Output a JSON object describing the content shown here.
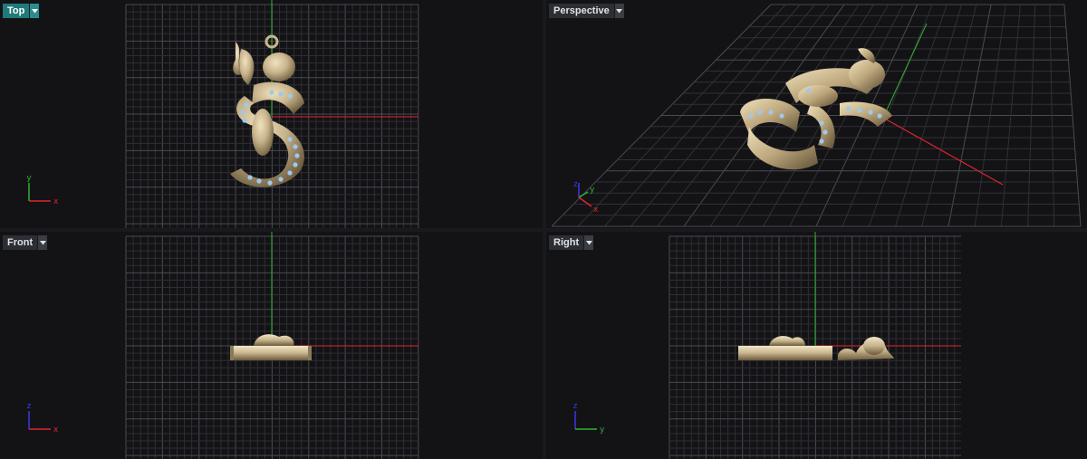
{
  "viewports": {
    "top": {
      "label": "Top",
      "active": true,
      "axes": [
        "y",
        "x"
      ]
    },
    "persp": {
      "label": "Perspective",
      "active": false,
      "axes": [
        "z",
        "y",
        "x"
      ]
    },
    "front": {
      "label": "Front",
      "active": false,
      "axes": [
        "z",
        "x"
      ]
    },
    "right": {
      "label": "Right",
      "active": false,
      "axes": [
        "z",
        "y"
      ]
    }
  },
  "colors": {
    "active_tab": "#217a7a",
    "x_axis": "#e0242c",
    "y_axis": "#2fb52f",
    "z_axis": "#3a3ae0",
    "gold": "#c8b48c",
    "gem": "#9ec8ee",
    "grid_minor": "#34343a",
    "grid_major": "#4a4a52"
  },
  "icons": {
    "dropdown": "chevron-down-icon",
    "axes": "axis-triad-icon"
  }
}
